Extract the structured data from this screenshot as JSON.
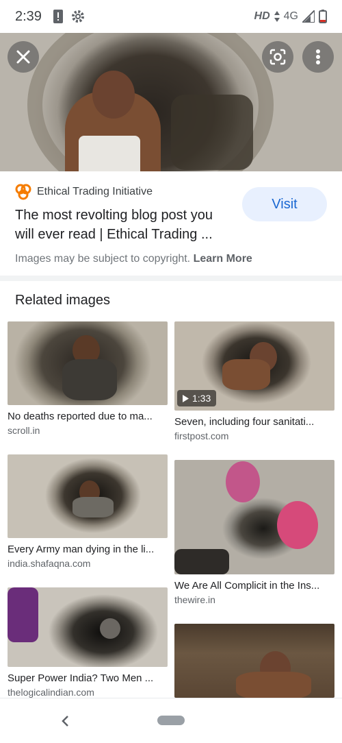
{
  "status": {
    "time": "2:39",
    "network_quality": "HD",
    "network_type": "4G"
  },
  "hero": {
    "close_icon": "close-icon",
    "lens_icon": "lens-icon",
    "more_icon": "more-vert-icon"
  },
  "result": {
    "source": "Ethical Trading Initiative",
    "title": "The most revolting blog post you will ever read | Ethical Trading ...",
    "visit_label": "Visit",
    "copyright_text": "Images may be subject to copyright.",
    "learn_more": "Learn More"
  },
  "related": {
    "heading": "Related images",
    "items": [
      {
        "caption": "No deaths reported due to ma...",
        "domain": "scroll.in",
        "duration": ""
      },
      {
        "caption": "Seven, including four sanitati...",
        "domain": "firstpost.com",
        "duration": "1:33"
      },
      {
        "caption": "Every Army man dying in the li...",
        "domain": "india.shafaqna.com",
        "duration": ""
      },
      {
        "caption": "We Are All Complicit in the Ins...",
        "domain": "thewire.in",
        "duration": ""
      },
      {
        "caption": "Super Power India? Two Men ...",
        "domain": "thelogicalindian.com",
        "duration": ""
      },
      {
        "caption": "",
        "domain": "",
        "duration": ""
      }
    ]
  },
  "colors": {
    "accent": "#1967d2",
    "visit_bg": "#e8f0fe",
    "source_logo": "#f57c00"
  }
}
